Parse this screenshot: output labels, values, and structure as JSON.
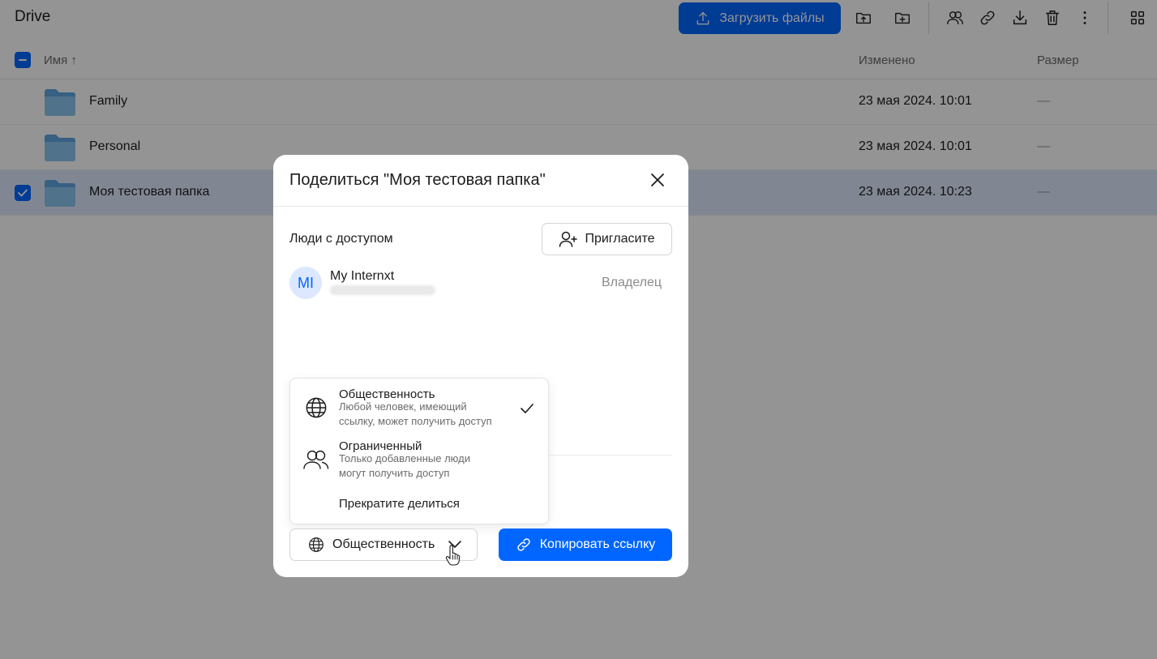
{
  "app": {
    "title": "Drive"
  },
  "toolbar": {
    "upload_label": "Загрузить файлы",
    "accent": "#0066ff",
    "icons": [
      "upload-folder-icon",
      "new-folder-icon",
      "share-users-icon",
      "link-icon",
      "download-icon",
      "trash-icon",
      "more-vertical-icon",
      "grid-view-icon"
    ]
  },
  "table": {
    "columns": {
      "name": "Имя",
      "modified": "Изменено",
      "size": "Размер"
    },
    "sort_indicator": "↑",
    "rows": [
      {
        "name": "Family",
        "modified": "23 мая 2024. 10:01",
        "size": "—",
        "selected": false
      },
      {
        "name": "Personal",
        "modified": "23 мая 2024. 10:01",
        "size": "—",
        "selected": false
      },
      {
        "name": "Моя тестовая папка",
        "modified": "23 мая 2024. 10:23",
        "size": "—",
        "selected": true
      }
    ]
  },
  "modal": {
    "title": "Поделиться \"Моя тестовая папка\"",
    "people_label": "Люди с доступом",
    "invite_label": "Пригласите",
    "user": {
      "initials": "MI",
      "name": "My Internxt",
      "role": "Владелец"
    },
    "access": {
      "selected_label": "Общественность",
      "options": [
        {
          "title": "Общественность",
          "desc_line1": "Любой человек, имеющий",
          "desc_line2": "ссылку, может получить доступ",
          "checked": true
        },
        {
          "title": "Ограниченный",
          "desc_line1": "Только добавленные люди",
          "desc_line2": "могут получить доступ",
          "checked": false
        },
        {
          "title": "Прекратите делиться",
          "checked": false
        }
      ]
    },
    "copy_link_label": "Копировать ссылку"
  }
}
